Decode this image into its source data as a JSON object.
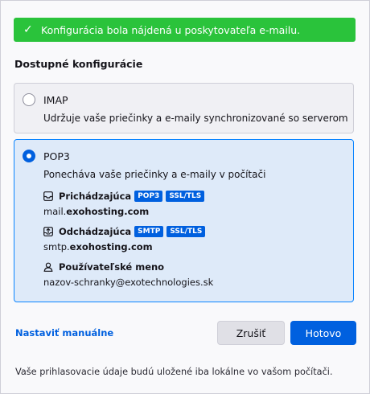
{
  "banner": {
    "icon": "check-icon",
    "text": "Konfigurácia bola nájdená u poskytovateľa e-mailu."
  },
  "section_title": "Dostupné konfigurácie",
  "options": {
    "imap": {
      "selected": false,
      "title": "IMAP",
      "description": "Udržuje vaše priečinky a e-maily synchronizované so serverom"
    },
    "pop3": {
      "selected": true,
      "title": "POP3",
      "description": "Ponecháva vaše priečinky a e-maily v počítači",
      "incoming": {
        "icon": "inbox-icon",
        "label": "Prichádzajúca",
        "badges": [
          "POP3",
          "SSL/TLS"
        ],
        "host_prefix": "mail.",
        "host_domain": "exohosting.com"
      },
      "outgoing": {
        "icon": "outbox-icon",
        "label": "Odchádzajúca",
        "badges": [
          "SMTP",
          "SSL/TLS"
        ],
        "host_prefix": "smtp.",
        "host_domain": "exohosting.com"
      },
      "username": {
        "icon": "user-icon",
        "label": "Používateľské meno",
        "value": "nazov-schranky@exotechnologies.sk"
      }
    }
  },
  "actions": {
    "manual_link": "Nastaviť manuálne",
    "cancel_label": "Zrušiť",
    "done_label": "Hotovo"
  },
  "footer_note": "Vaše prihlasovacie údaje budú uložené iba lokálne vo vašom počítači.",
  "colors": {
    "success": "#2ac33b",
    "accent": "#0060df",
    "selected_bg": "#deeaf9"
  }
}
